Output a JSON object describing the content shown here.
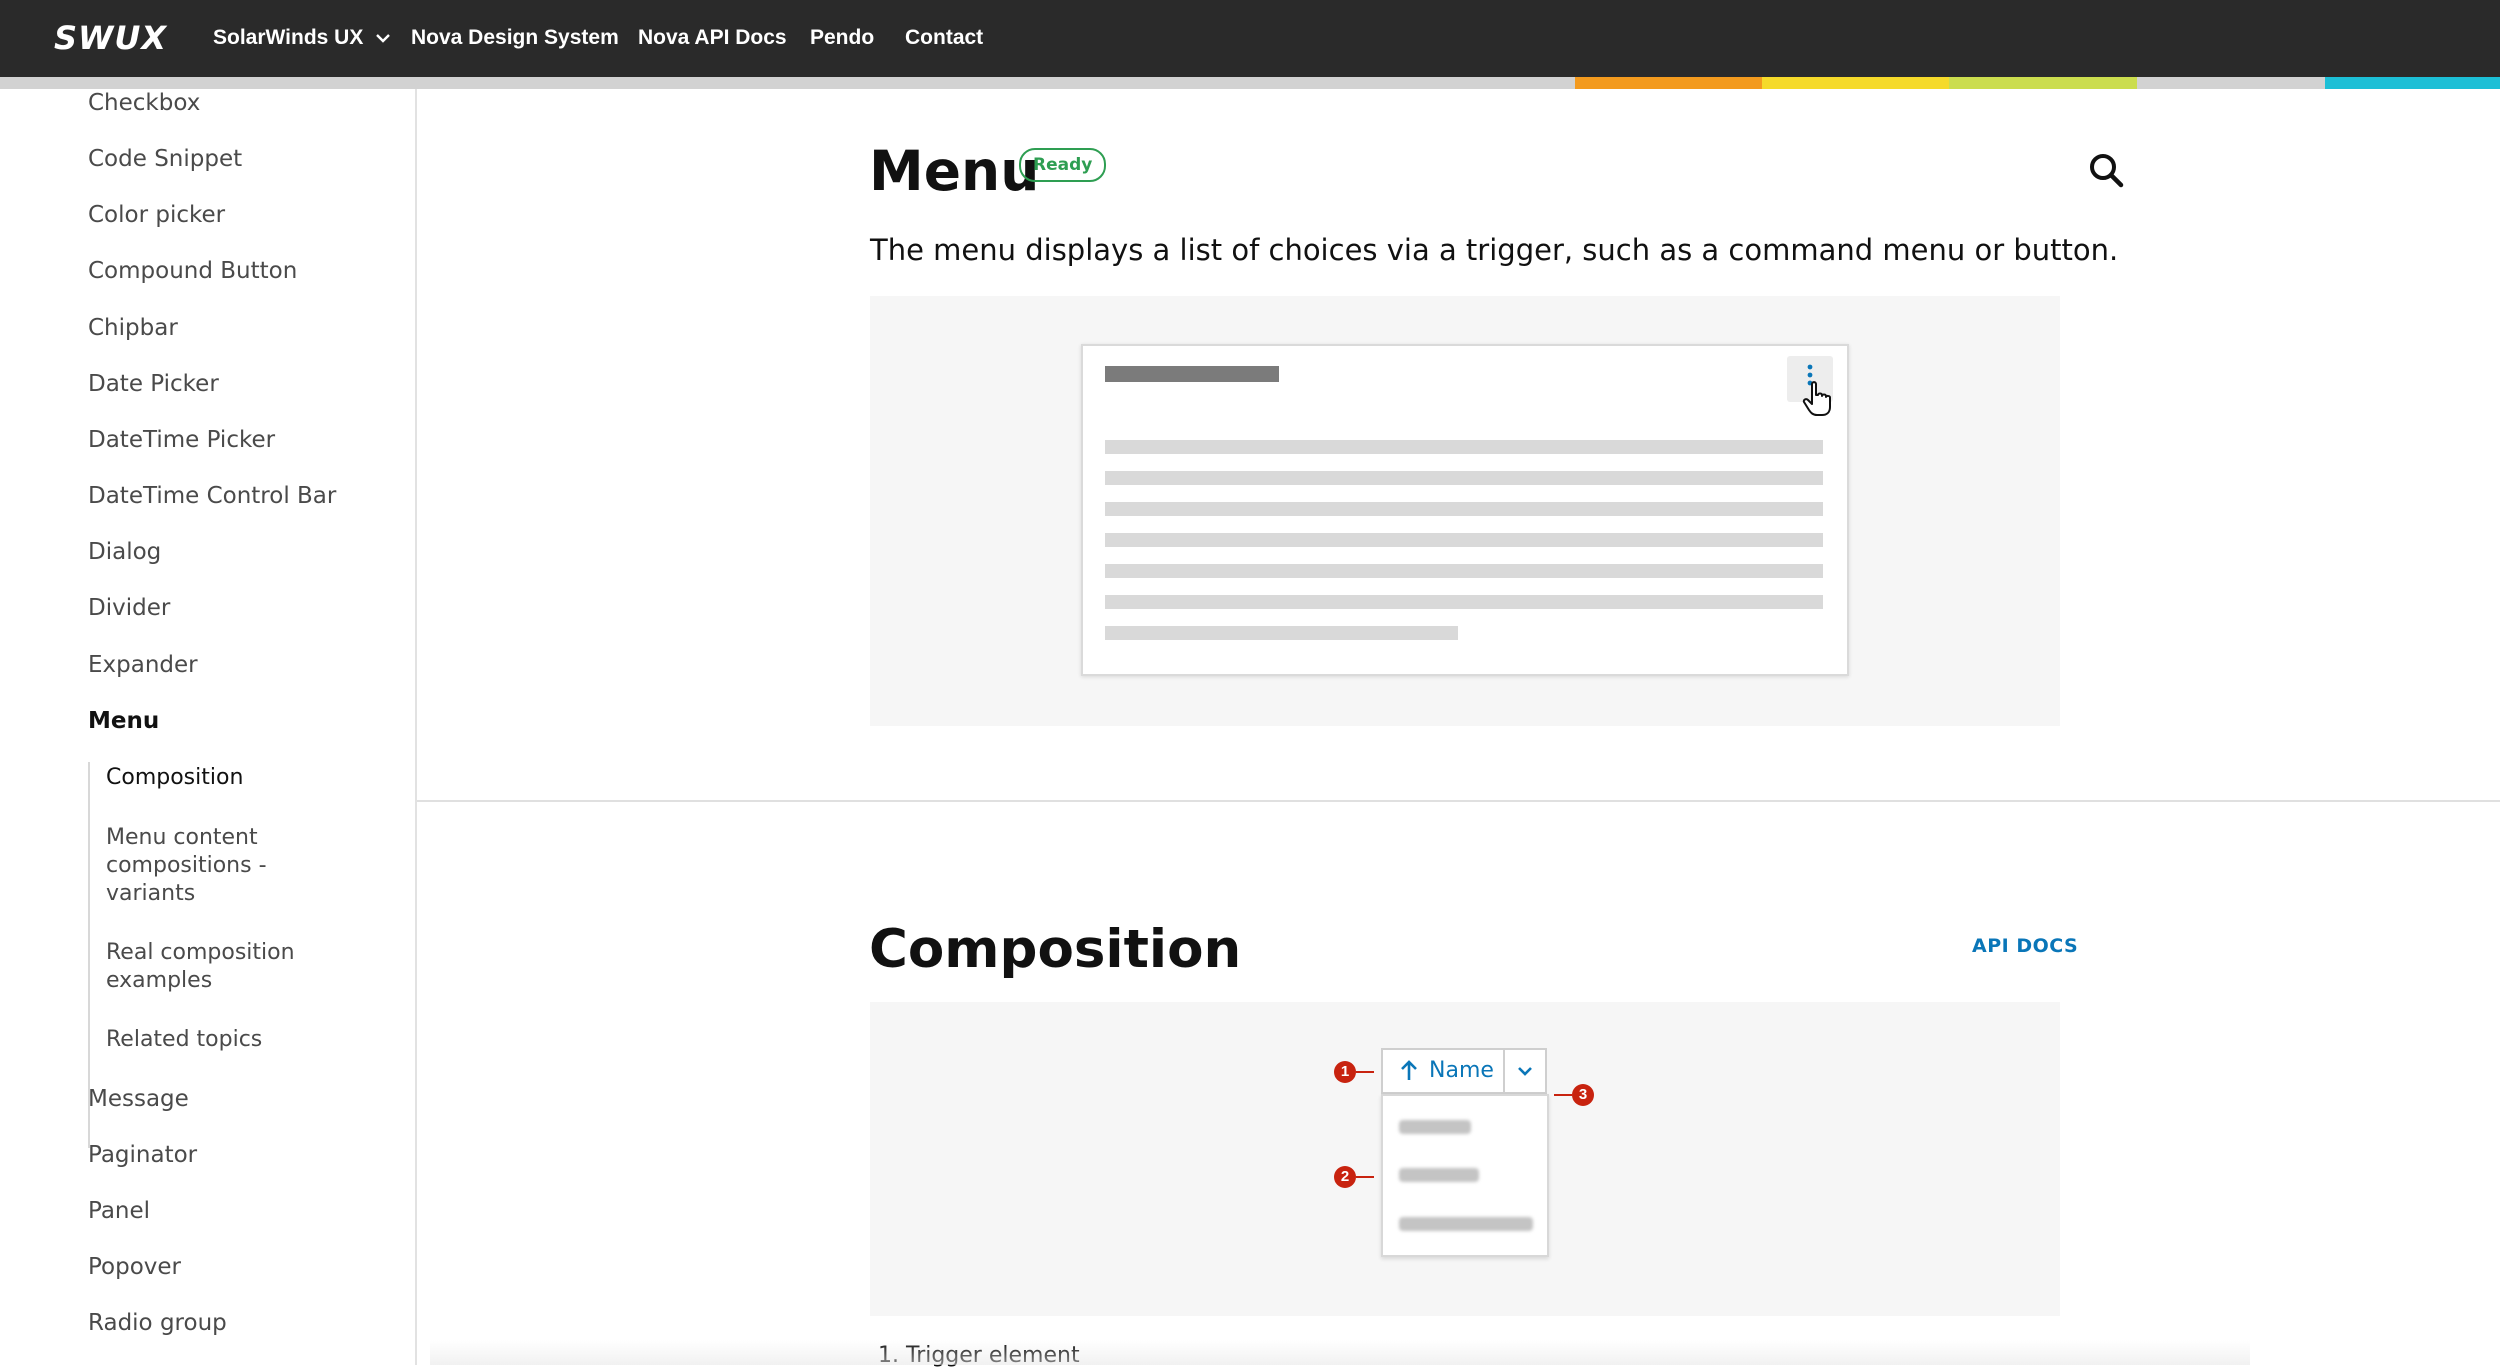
{
  "header": {
    "logo": "SWUX",
    "nav": [
      {
        "label": "SolarWinds UX",
        "has_dropdown": true
      },
      {
        "label": "Nova Design System"
      },
      {
        "label": "Nova API Docs"
      },
      {
        "label": "Pendo"
      },
      {
        "label": "Contact"
      }
    ],
    "stripe_colors": [
      "#f39a1e",
      "#f5da2a",
      "#cbdd4e",
      "#1cbfd6"
    ]
  },
  "sidebar": {
    "items": [
      {
        "label": "Checkbox"
      },
      {
        "label": "Code Snippet"
      },
      {
        "label": "Color picker"
      },
      {
        "label": "Compound Button"
      },
      {
        "label": "Chipbar"
      },
      {
        "label": "Date Picker"
      },
      {
        "label": "DateTime Picker"
      },
      {
        "label": "DateTime Control Bar"
      },
      {
        "label": "Dialog"
      },
      {
        "label": "Divider"
      },
      {
        "label": "Expander"
      },
      {
        "label": "Menu",
        "active": true
      }
    ],
    "sub_items": [
      {
        "label": "Composition",
        "active": true
      },
      {
        "label": "Menu content compositions - variants"
      },
      {
        "label": "Real composition examples"
      },
      {
        "label": "Related topics"
      }
    ],
    "items_after": [
      {
        "label": "Message"
      },
      {
        "label": "Paginator"
      },
      {
        "label": "Panel"
      },
      {
        "label": "Popover"
      },
      {
        "label": "Radio group"
      }
    ]
  },
  "main": {
    "title": "Menu",
    "status_badge": "Ready",
    "description": "The menu displays a list of choices via a trigger, such as a command menu or button.",
    "search_icon": "search-icon",
    "section": {
      "title": "Composition",
      "api_link": "API DOCS",
      "trigger_label": "Name",
      "callouts": [
        "1",
        "2",
        "3"
      ],
      "list_item_1": "1. Trigger element"
    }
  },
  "colors": {
    "accent_blue": "#0a76b8",
    "ready_green": "#2e9e52",
    "callout_red": "#c8230f",
    "topbar": "#2a2a2a"
  }
}
